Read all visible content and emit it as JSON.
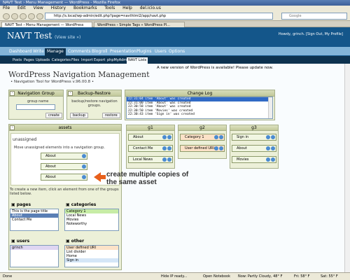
{
  "browser": {
    "window_title": "NAVT Test › Menu Management — WordPress - Mozilla Firefox",
    "menu": [
      "File",
      "Edit",
      "View",
      "History",
      "Bookmarks",
      "Tools",
      "Help",
      "del.icio.us"
    ],
    "url": "http://s.local/wp-admin/edit.php?page=navthtml2/app/navt.php",
    "search_placeholder": "Google",
    "tabs": [
      "NAVT Test › Menu Management — WordPress",
      "WordPress › Simple Tags « WordPress Pl..."
    ]
  },
  "wp": {
    "site_title": "NAVT Test",
    "view_site": "(View site »)",
    "user_greeting": "Howdy, grinch. [Sign Out, My Profile]",
    "menu": [
      "Dashboard",
      "Write",
      "Manage",
      "Comments",
      "Blogroll",
      "Presentation",
      "Plugins",
      "Users",
      "Options"
    ],
    "active_menu": "Manage",
    "submenu": [
      "Posts",
      "Pages",
      "Uploads",
      "Categories",
      "Files",
      "Import",
      "Export",
      "phpMyAdmin",
      "NAVT Lists"
    ],
    "active_submenu": "NAVT Lists",
    "update_notice": "A new version of WordPress is available! Please update now."
  },
  "page": {
    "title": "WordPress Navigation Management",
    "subtitle": "• Navigation Tool for WordPress v.96.00.8 •"
  },
  "nav_group": {
    "title": "Navigation Group",
    "group_name_label": "group name",
    "create_label": "create"
  },
  "backup": {
    "title": "Backup-Restore",
    "description": "backup/restore navigation groups.",
    "backup_label": "backup",
    "restore_label": "restore"
  },
  "changelog": {
    "title": "Change Log",
    "entries": [
      "22:31:04 item 'About' was created",
      "22:31:00 item 'About' was created",
      "22:30:58 item 'About' was created",
      "22:30:50 item 'Movies' was created",
      "22:30:43 item 'Sign in' was created"
    ]
  },
  "assets": {
    "title": "assets",
    "unassigned_label": "unassigned",
    "unassigned_help": "Move unassigned elements into a navigation group.",
    "unassigned_items": [
      "About",
      "About",
      "About"
    ],
    "create_help": "To create a new item, click an element from one of the groups listed below.",
    "pages_title": "pages",
    "pages_items": [
      "This is the page title",
      "About",
      "Contact Me"
    ],
    "categories_title": "categories",
    "categories_items": [
      "Category 1",
      "Local News",
      "Movies",
      "Noteworthy"
    ],
    "users_title": "users",
    "users_items": [
      "grinch"
    ],
    "other_title": "other",
    "other_items": [
      "User defined URI",
      "List divider",
      "Home",
      "Sign in"
    ]
  },
  "groups": [
    {
      "name": "g1",
      "items": [
        "About",
        "Contact Me",
        "Local News"
      ]
    },
    {
      "name": "g2",
      "items": [
        "Category 1",
        "User defined URI"
      ]
    },
    {
      "name": "g3",
      "items": [
        "Sign in",
        "About",
        "Movies"
      ]
    }
  ],
  "callout": "create multiple copies of the same asset",
  "status_bar": {
    "left": "Done",
    "items": [
      "Hide IP ready...",
      "Open Notebook",
      "Now: Partly Cloudy, 48° F",
      "Fri: 58° F",
      "Sat: 55° F"
    ]
  }
}
